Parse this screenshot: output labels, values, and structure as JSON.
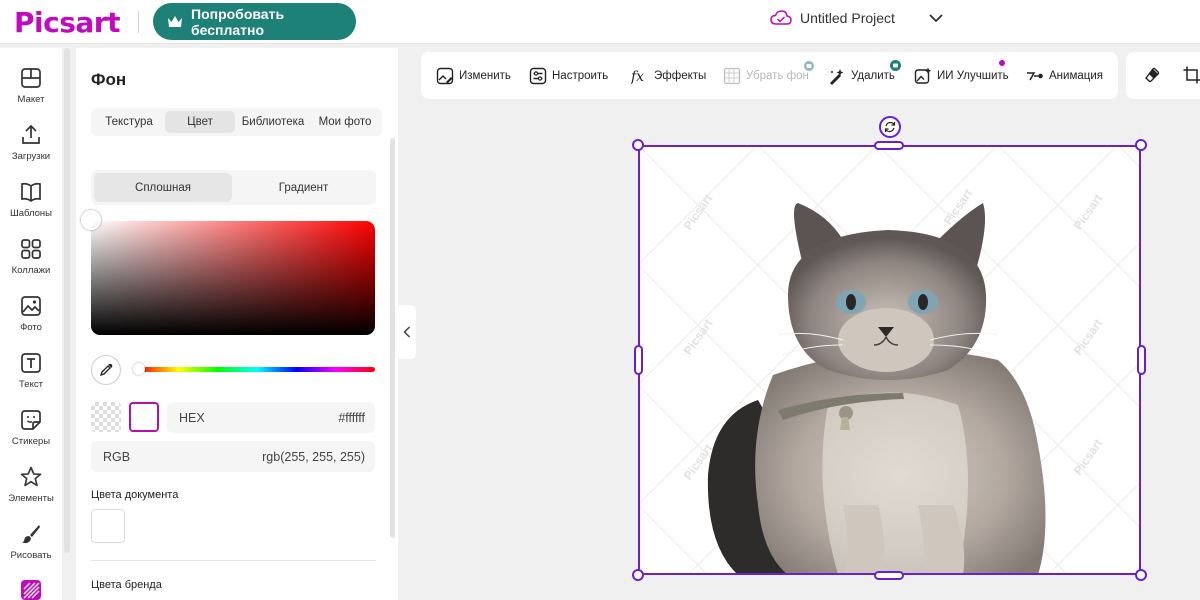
{
  "app": {
    "logo": "Picsart",
    "try_button": "Попробовать бесплатно",
    "project_title": "Untitled Project"
  },
  "rail": [
    {
      "label": "Макет",
      "icon": "layout-icon"
    },
    {
      "label": "Загрузки",
      "icon": "upload-icon"
    },
    {
      "label": "Шаблоны",
      "icon": "templates-icon"
    },
    {
      "label": "Коллажи",
      "icon": "collage-icon"
    },
    {
      "label": "Фото",
      "icon": "photo-icon"
    },
    {
      "label": "Текст",
      "icon": "text-icon"
    },
    {
      "label": "Стикеры",
      "icon": "stickers-icon"
    },
    {
      "label": "Элементы",
      "icon": "elements-icon"
    },
    {
      "label": "Рисовать",
      "icon": "brush-icon"
    }
  ],
  "panel": {
    "title": "Фон",
    "tabs": [
      "Текстура",
      "Цвет",
      "Библиотека",
      "Мои фото"
    ],
    "active_tab": "Цвет",
    "mode": [
      "Сплошная",
      "Градиент"
    ],
    "hex_label": "HEX",
    "hex_value": "#ffffff",
    "rgb_label": "RGB",
    "rgb_value": "rgb(255, 255, 255)",
    "doc_colors": "Цвета документа",
    "brand_colors": "Цвета бренда"
  },
  "toolbar": {
    "edit": "Изменить",
    "adjust": "Настроить",
    "effects": "Эффекты",
    "remove_bg": "Убрать фон",
    "delete": "Удалить",
    "ai_enhance": "ИИ Улучшить",
    "animation": "Анимация"
  },
  "canvas": {
    "watermark": "Picsart"
  },
  "colors": {
    "accent": "#c209c1",
    "primary_btn": "#1e8177",
    "selection": "#6a1fd1"
  }
}
